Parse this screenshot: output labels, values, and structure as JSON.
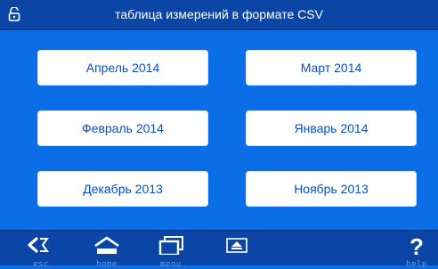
{
  "header": {
    "title": "таблица измерений в формате CSV",
    "lock_icon": "unlocked-padlock-icon"
  },
  "months": [
    {
      "label": "Апрель 2014"
    },
    {
      "label": "Март 2014"
    },
    {
      "label": "Февраль 2014"
    },
    {
      "label": "Январь 2014"
    },
    {
      "label": "Декабрь 2013"
    },
    {
      "label": "Ноябрь 2013"
    }
  ],
  "footer": {
    "esc_label": "esc",
    "home_label": "home",
    "menu_label": "menu",
    "help_label": "help"
  },
  "colors": {
    "background": "#0c6ee6",
    "bar": "#0b46a6",
    "button_text": "#0b4fc4",
    "icon": "#ffffff"
  }
}
